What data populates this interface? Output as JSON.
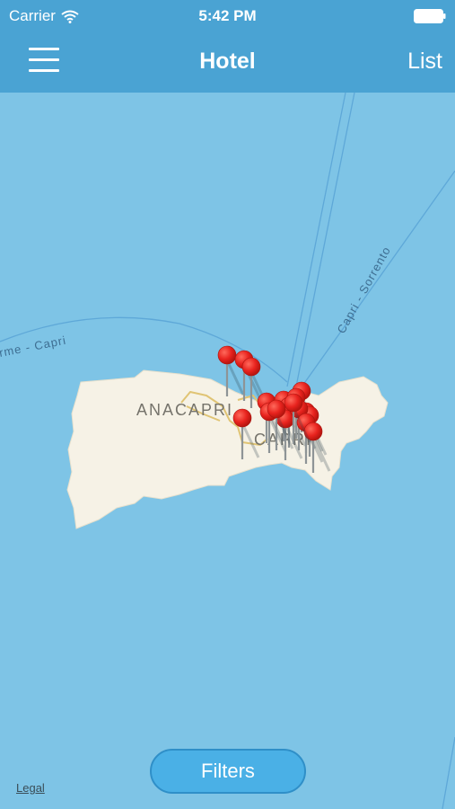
{
  "status_bar": {
    "carrier": "Carrier",
    "time": "5:42 PM",
    "wifi_icon": "wifi-icon",
    "battery_icon": "battery-icon"
  },
  "nav": {
    "title": "Hotel",
    "right_button": "List",
    "menu_icon": "hamburger-menu-icon"
  },
  "map": {
    "labels": {
      "town1": "ANACAPRI",
      "town2": "CAPRI",
      "ferry1": "Capri - Sorrento",
      "ferry2": "rme - Capri"
    },
    "pin_icon": "map-pin-icon",
    "pin_count": 18,
    "colors": {
      "sea": "#7ec4e6",
      "land": "#f6f2e6",
      "pin": "#e8231e",
      "header": "#4aa3d3"
    }
  },
  "filters": {
    "label": "Filters"
  },
  "legal": {
    "label": "Legal"
  }
}
